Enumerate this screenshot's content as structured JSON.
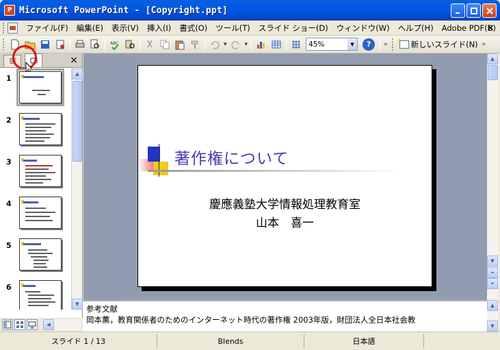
{
  "window": {
    "title": "Microsoft PowerPoint - [Copyright.ppt]",
    "app_icon_label": "P"
  },
  "menu": {
    "items": [
      "ファイル(F)",
      "編集(E)",
      "表示(V)",
      "挿入(I)",
      "書式(O)",
      "ツール(T)",
      "スライド ショー(D)",
      "ウィンドウ(W)",
      "ヘルプ(H)",
      "Adobe PDF(B)"
    ],
    "close_label": "×"
  },
  "toolbar": {
    "zoom_value": "45%",
    "new_slide_label": "新しいスライド(N)",
    "help_label": "?"
  },
  "outline_pane": {
    "close_label": "×",
    "tab_outline_icon": "outline-icon",
    "tab_slides_icon": "slides-icon",
    "slide_numbers": [
      "1",
      "2",
      "3",
      "4",
      "5",
      "6"
    ]
  },
  "slide": {
    "title": "著作権について",
    "subtitle_line1": "慶應義塾大学情報処理教育室",
    "subtitle_line2": "山本　喜一"
  },
  "notes": {
    "line1": "参考文献",
    "line2": "岡本薫，教育関係者のためのインターネット時代の著作権 2003年版，財団法人全日本社会教"
  },
  "status": {
    "slide_indicator": "スライド 1 / 13",
    "design": "Blends",
    "language": "日本語"
  },
  "colors": {
    "titlebar": "#0058e6",
    "slide_title": "#4a3cb0",
    "accent_red": "#e01010"
  }
}
